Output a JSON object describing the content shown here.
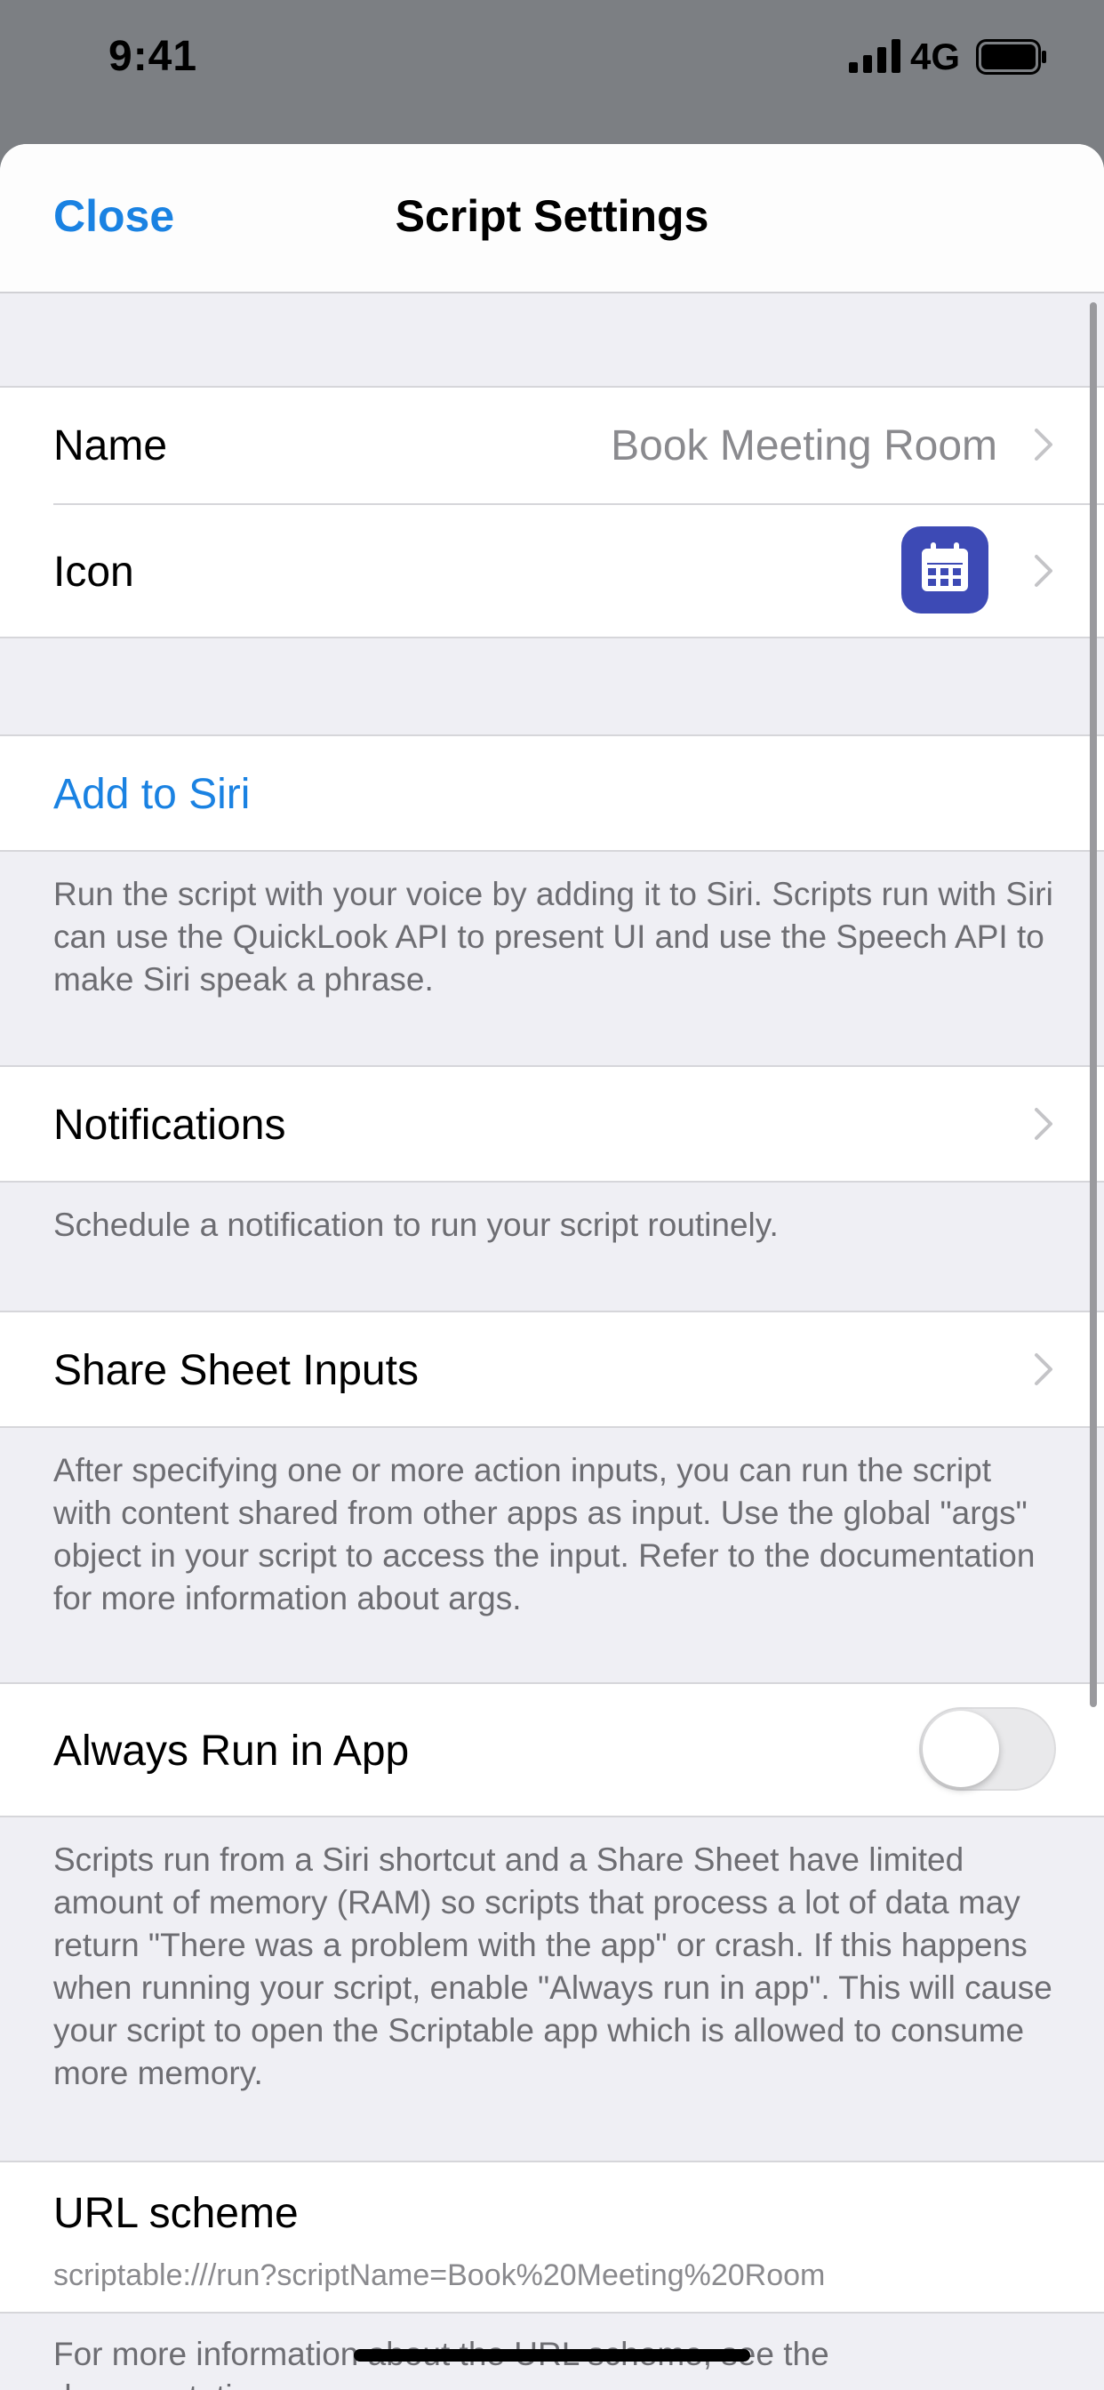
{
  "status_bar": {
    "time": "9:41",
    "network": "4G",
    "icons": [
      "signal-bars-icon",
      "battery-icon"
    ]
  },
  "nav": {
    "close_label": "Close",
    "title": "Script Settings"
  },
  "general": {
    "name_label": "Name",
    "name_value": "Book Meeting Room",
    "icon_label": "Icon",
    "icon_name": "calendar-icon",
    "icon_color": "#3d4ab5"
  },
  "siri": {
    "add_label": "Add to Siri",
    "footer": "Run the script with your voice by adding it to Siri. Scripts run with Siri can use the QuickLook API to present UI and use the Speech API to make Siri speak a phrase."
  },
  "notifications": {
    "label": "Notifications",
    "footer": "Schedule a notification to run your script routinely."
  },
  "share_sheet": {
    "label": "Share Sheet Inputs",
    "footer": "After specifying one or more action inputs, you can run the script with content shared from other apps as input. Use the global \"args\" object in your script to access the input. Refer to the documentation for more information about args."
  },
  "always_run": {
    "label": "Always Run in App",
    "enabled": false,
    "footer": "Scripts run from a Siri shortcut and a Share Sheet have limited amount of memory (RAM) so scripts that process a lot of data may return \"There was a problem with the app\" or crash. If this happens when running your script, enable \"Always run in app\". This will cause your script to open the Scriptable app which is allowed to consume more memory."
  },
  "url_scheme": {
    "label": "URL scheme",
    "value": "scriptable:///run?scriptName=Book%20Meeting%20Room",
    "footer": "For more information about the URL scheme, see the documentation."
  },
  "colors": {
    "accent": "#1a82e2",
    "background": "#efeff4",
    "secondary_text": "#6d6d72"
  }
}
